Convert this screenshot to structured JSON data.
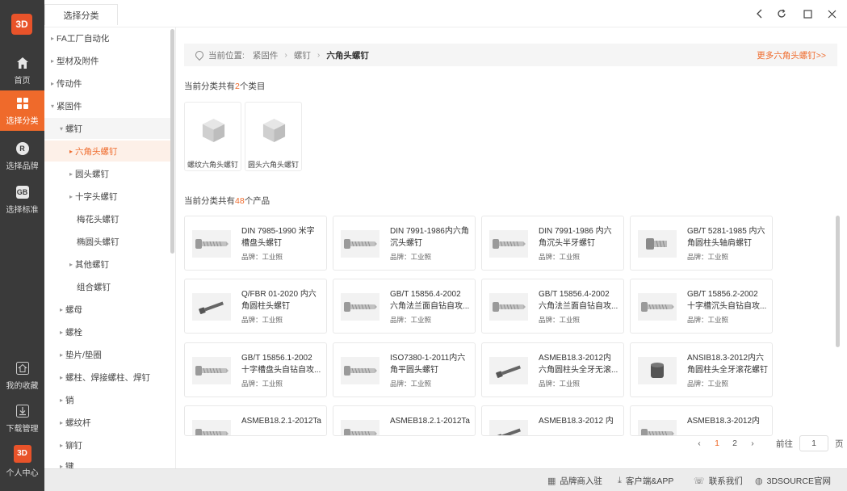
{
  "app": {
    "logo": "3D",
    "tab": "选择分类"
  },
  "rail": {
    "items": [
      {
        "label": "首页",
        "icon": "home-icon"
      },
      {
        "label": "选择分类",
        "icon": "grid-icon"
      },
      {
        "label": "选择品牌",
        "icon": "brand-icon",
        "badge": "R"
      },
      {
        "label": "选择标准",
        "icon": "standard-icon",
        "badge": "GB"
      }
    ],
    "bottom": [
      {
        "label": "我的收藏",
        "icon": "favorite-icon"
      },
      {
        "label": "下载管理",
        "icon": "download-icon"
      },
      {
        "label": "个人中心",
        "icon": "user-icon",
        "badge": "3D"
      }
    ]
  },
  "sidebar": {
    "items": [
      {
        "label": "FA工厂自动化",
        "level": 0
      },
      {
        "label": "型材及附件",
        "level": 0
      },
      {
        "label": "传动件",
        "level": 0
      },
      {
        "label": "紧固件",
        "level": 0,
        "open": true
      },
      {
        "label": "螺钉",
        "level": 1,
        "open": true
      },
      {
        "label": "六角头螺钉",
        "level": 2,
        "selected": true
      },
      {
        "label": "圆头螺钉",
        "level": 2
      },
      {
        "label": "十字头螺钉",
        "level": 2
      },
      {
        "label": "梅花头螺钉",
        "level": 3
      },
      {
        "label": "椭圆头螺钉",
        "level": 3
      },
      {
        "label": "其他螺钉",
        "level": 2
      },
      {
        "label": "组合螺钉",
        "level": 3
      },
      {
        "label": "螺母",
        "level": 1
      },
      {
        "label": "螺栓",
        "level": 1
      },
      {
        "label": "垫片/垫圈",
        "level": 1
      },
      {
        "label": "螺柱、焊接螺柱、焊钉",
        "level": 1
      },
      {
        "label": "销",
        "level": 1
      },
      {
        "label": "螺纹杆",
        "level": 1
      },
      {
        "label": "铆钉",
        "level": 1
      },
      {
        "label": "键",
        "level": 1
      }
    ]
  },
  "breadcrumb": {
    "prefix": "当前位置:",
    "items": [
      "紧固件",
      "螺钉"
    ],
    "current": "六角头螺钉",
    "more": "更多六角头螺钉>>"
  },
  "categories": {
    "text_before": "当前分类共有",
    "count": "2",
    "text_after": "个类目",
    "items": [
      "螺纹六角头螺钉",
      "圆头六角头螺钉"
    ]
  },
  "products": {
    "text_before": "当前分类共有",
    "count": "48",
    "text_after": "个产品",
    "items": [
      {
        "title": "DIN 7985-1990 米字槽盘头螺钉",
        "brand": "品牌：工业照",
        "thumb": "screw"
      },
      {
        "title": "DIN 7991-1986内六角沉头螺钉",
        "brand": "品牌：工业照",
        "thumb": "screw"
      },
      {
        "title": "DIN 7991-1986 内六角沉头半牙螺钉",
        "brand": "品牌：工业照",
        "thumb": "screw"
      },
      {
        "title": "GB/T 5281-1985 内六角圆柱头轴肩螺钉",
        "brand": "品牌：工业照",
        "thumb": "screw-short"
      },
      {
        "title": "Q/FBR 01-2020 内六角圆柱头螺钉",
        "brand": "品牌：工业照",
        "thumb": "pin"
      },
      {
        "title": "GB/T 15856.4-2002 六角法兰面自钻自攻...",
        "brand": "品牌：工业照",
        "thumb": "screw"
      },
      {
        "title": "GB/T 15856.4-2002 六角法兰面自钻自攻...",
        "brand": "品牌：工业照",
        "thumb": "screw"
      },
      {
        "title": "GB/T 15856.2-2002 十字槽沉头自钻自攻...",
        "brand": "品牌：工业照",
        "thumb": "screw"
      },
      {
        "title": "GB/T 15856.1-2002 十字槽盘头自钻自攻...",
        "brand": "品牌：工业照",
        "thumb": "screw"
      },
      {
        "title": "ISO7380-1-2011内六角平圆头螺钉",
        "brand": "品牌：工业照",
        "thumb": "screw"
      },
      {
        "title": "ASMEB18.3-2012内六角圆柱头全牙无滚...",
        "brand": "品牌：工业照",
        "thumb": "pin"
      },
      {
        "title": "ANSIB18.3-2012内六角圆柱头全牙滚花螺钉",
        "brand": "品牌：工业照",
        "thumb": "cap"
      },
      {
        "title": "ASMEB18.2.1-2012Ta",
        "brand": "",
        "thumb": "screw"
      },
      {
        "title": "ASMEB18.2.1-2012Ta",
        "brand": "",
        "thumb": "screw"
      },
      {
        "title": "ASMEB18.3-2012 内",
        "brand": "",
        "thumb": "pin"
      },
      {
        "title": "ASMEB18.3-2012内",
        "brand": "",
        "thumb": "screw"
      }
    ]
  },
  "pagination": {
    "pages": [
      "1",
      "2"
    ],
    "current": "1",
    "prev": "‹",
    "next": "›",
    "goto_label": "前往",
    "goto_value": "1",
    "page_suffix": "页"
  },
  "footer": {
    "links": [
      {
        "label": "品牌商入驻",
        "icon": "store-icon"
      },
      {
        "label": "客户端&APP",
        "icon": "download-icon"
      },
      {
        "label": "联系我们",
        "icon": "phone-icon"
      },
      {
        "label": "3DSOURCE官网",
        "icon": "globe-icon"
      }
    ]
  },
  "colors": {
    "accent": "#ef6a2b",
    "rail": "#3a3a3a"
  }
}
